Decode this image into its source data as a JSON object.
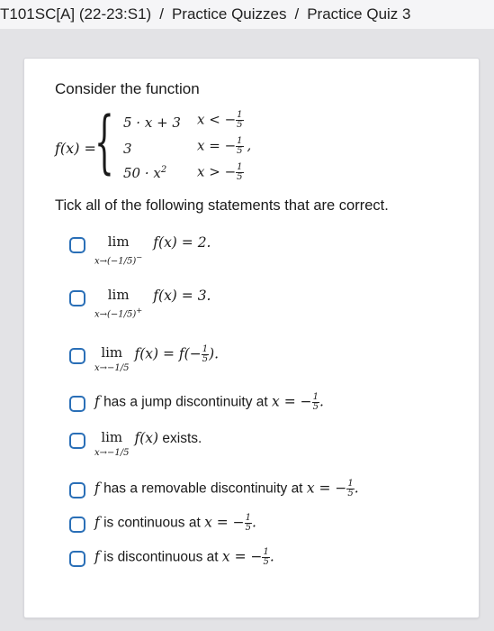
{
  "breadcrumb": {
    "course": "T101SC[A] (22-23:S1)",
    "separator": "/",
    "section": "Practice Quizzes",
    "page": "Practice Quiz 3"
  },
  "question": {
    "intro": "Consider the function",
    "function_name": "f(x) =",
    "cases": [
      {
        "expr": "5 · x + 3",
        "cond": "x < −",
        "frac_num": "1",
        "frac_den": "5",
        "trail": ""
      },
      {
        "expr": "3",
        "cond": "x = −",
        "frac_num": "1",
        "frac_den": "5",
        "trail": ","
      },
      {
        "expr": "50 · x",
        "expr_sup": "2",
        "cond": "x > −",
        "frac_num": "1",
        "frac_den": "5",
        "trail": ""
      }
    ],
    "instruction": "Tick all of the following statements that are correct."
  },
  "options": [
    {
      "lim_word": "lim",
      "sub": "x→(−1/5)",
      "sub_sup": "−",
      "body": "f(x) = 2."
    },
    {
      "lim_word": "lim",
      "sub": "x→(−1/5)",
      "sub_sup": "+",
      "body": "f(x) = 3."
    },
    {
      "lim_word": "lim",
      "sub": "x→−1/5",
      "body_pre": "f(x) = f(−",
      "frac_num": "1",
      "frac_den": "5",
      "body_post": ")."
    },
    {
      "pre": "f",
      "text": "has a jump discontinuity at",
      "var": "x = −",
      "frac_num": "1",
      "frac_den": "5",
      "post": "."
    },
    {
      "lim_word": "lim",
      "sub": "x→−1/5",
      "body": "f(x)",
      "text_after": "exists."
    },
    {
      "pre": "f",
      "text": "has a removable discontinuity at",
      "var": "x = −",
      "frac_num": "1",
      "frac_den": "5",
      "post": "."
    },
    {
      "pre": "f",
      "text": "is continuous at",
      "var": "x = −",
      "frac_num": "1",
      "frac_den": "5",
      "post": "."
    },
    {
      "pre": "f",
      "text": "is discontinuous at",
      "var": "x = −",
      "frac_num": "1",
      "frac_den": "5",
      "post": "."
    }
  ],
  "colors": {
    "checkbox_border": "#2a6fb7",
    "card_bg": "#ffffff",
    "page_bg": "#e3e3e6"
  }
}
